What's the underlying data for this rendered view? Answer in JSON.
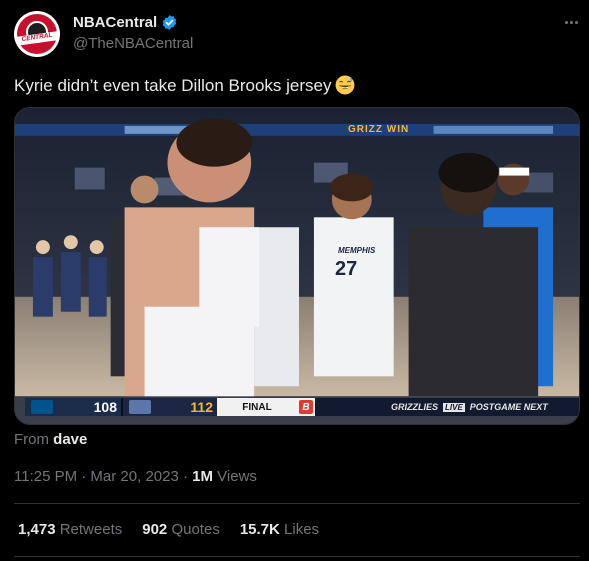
{
  "author": {
    "display_name": "NBACentral",
    "handle": "@TheNBACentral",
    "avatar_text": "CENTRAL",
    "verified": true
  },
  "tweet": {
    "text": "Kyrie didn’t even take Dillon Brooks jersey",
    "emoji": "grinning-face-with-sweat"
  },
  "media": {
    "scoreboard": {
      "away_score": "108",
      "home_score": "112",
      "status": "FINAL",
      "promo": "GRIZZLIES",
      "promo_live": "LIVE",
      "promo_tail": "POSTGAME NEXT"
    },
    "arena_banner": "GRIZZ WIN",
    "jersey_number": "27",
    "jersey_team": "MEMPHIS"
  },
  "from": {
    "prefix": "From",
    "user": "dave"
  },
  "meta": {
    "timestamp": "11:25 PM · Mar 20, 2023 · ",
    "views_count": "1M",
    "views_label": "Views"
  },
  "stats": {
    "retweets_count": "1,473",
    "retweets_label": "Retweets",
    "quotes_count": "902",
    "quotes_label": "Quotes",
    "likes_count": "15.7K",
    "likes_label": "Likes"
  },
  "colors": {
    "background": "#000000",
    "text": "#e7e9ea",
    "muted": "#71767b",
    "verified": "#1d9bf0",
    "divider": "#2f3336"
  }
}
